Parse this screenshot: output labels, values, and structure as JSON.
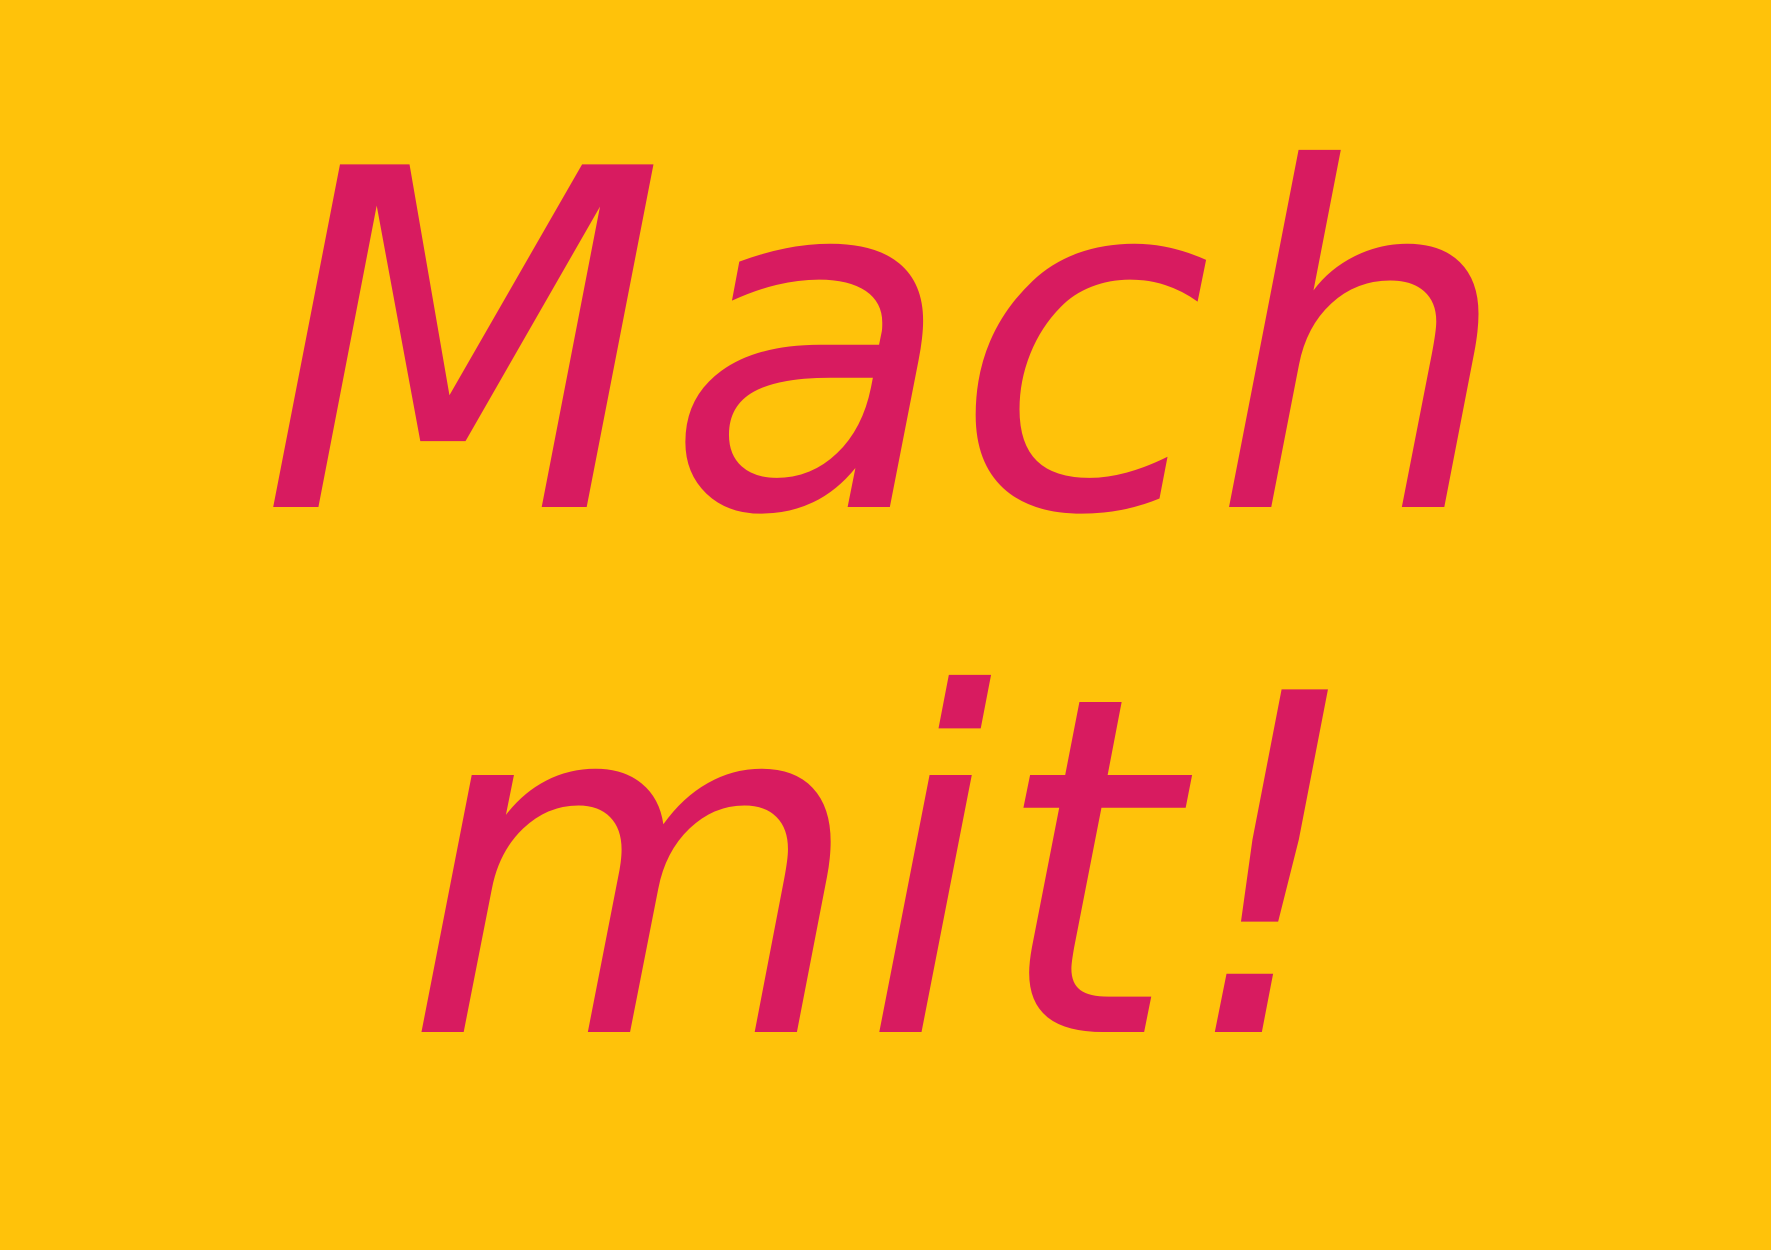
{
  "poster": {
    "line1": "Mach",
    "line2": "mit!"
  },
  "colors": {
    "background": "#FFC20A",
    "text": "#D81B60"
  }
}
